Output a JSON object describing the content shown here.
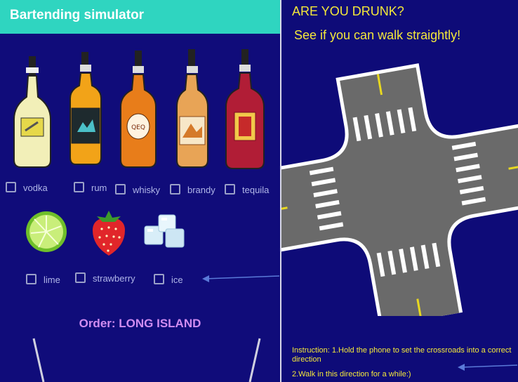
{
  "left": {
    "app_title": "Bartending simulator",
    "spirits": [
      {
        "label": "vodka",
        "icon": "vodka-bottle-icon"
      },
      {
        "label": "rum",
        "icon": "rum-bottle-icon"
      },
      {
        "label": "whisky",
        "icon": "whisky-bottle-icon"
      },
      {
        "label": "brandy",
        "icon": "brandy-bottle-icon"
      },
      {
        "label": "tequila",
        "icon": "tequila-bottle-icon"
      }
    ],
    "extras": [
      {
        "label": "lime",
        "icon": "lime-icon"
      },
      {
        "label": "strawberry",
        "icon": "strawberry-icon"
      },
      {
        "label": "ice",
        "icon": "ice-cubes-icon"
      }
    ],
    "order_text": "Order: LONG ISLAND"
  },
  "right": {
    "title": "ARE YOU DRUNK?",
    "subtitle": "See if you can walk straightly!",
    "instruction_1": "Instruction: 1.Hold the phone to set the crossroads into a correct direction",
    "instruction_2": "2.Walk in this direction for a while:)"
  },
  "colors": {
    "background": "#100c7a",
    "appbar": "#2fd5c0",
    "yellow_text": "#f4e83a",
    "order_text": "#d08cf0",
    "road": "#6a6a6a"
  }
}
